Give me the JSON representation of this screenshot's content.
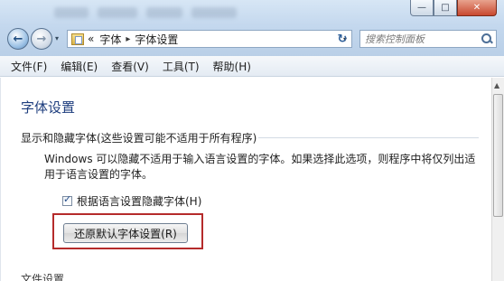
{
  "window": {
    "caption_buttons": {
      "minimize": "—",
      "maximize": "□",
      "close": "✕"
    }
  },
  "nav": {
    "back_glyph": "←",
    "forward_glyph": "→",
    "history_dropdown_glyph": "▾"
  },
  "address": {
    "overflow_glyph": "«",
    "crumbs": [
      "字体",
      "字体设置"
    ],
    "separator": "▸",
    "dropdown_glyph": "▾",
    "refresh_glyph": "↻"
  },
  "search": {
    "placeholder": "搜索控制面板"
  },
  "menu": {
    "items": [
      "文件(F)",
      "编辑(E)",
      "查看(V)",
      "工具(T)",
      "帮助(H)"
    ]
  },
  "main": {
    "title": "字体设置",
    "section_heading": "显示和隐藏字体(这些设置可能不适用于所有程序)",
    "description": "Windows 可以隐藏不适用于输入语言设置的字体。如果选择此选项，则程序中将仅列出适用于语言设置的字体。",
    "checkbox_label": "根据语言设置隐藏字体(H)",
    "checkbox_checked": true,
    "restore_button": "还原默认字体设置(R)",
    "next_section_partial": "文件设置"
  },
  "colors": {
    "title_blue": "#1e3e7e",
    "highlight_red": "#b52b2b"
  }
}
